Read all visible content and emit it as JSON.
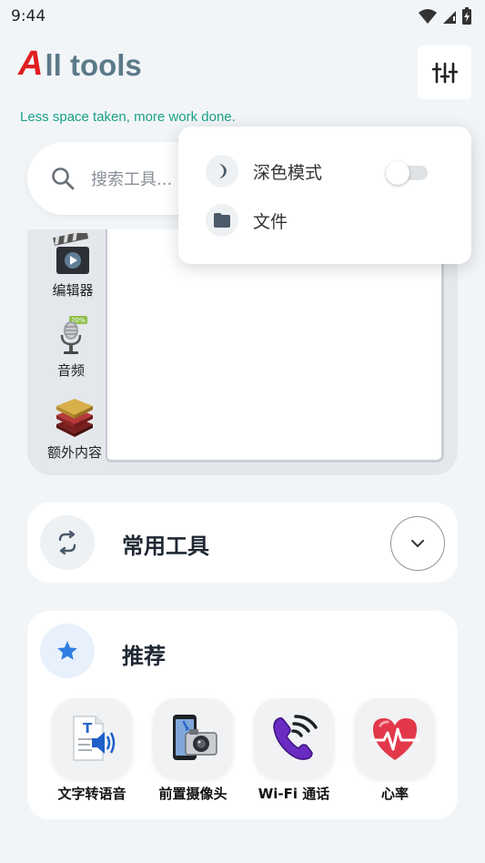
{
  "status_bar": {
    "time": "9:44"
  },
  "header": {
    "logo_letter": "A",
    "title_rest": "ll tools",
    "tagline": "Less space taken, more work done."
  },
  "search": {
    "placeholder": "搜索工具..."
  },
  "categories": [
    {
      "label": "编辑器",
      "icon": "video-clapper-icon"
    },
    {
      "label": "音频",
      "icon": "microphone-icon",
      "badge": "20%"
    },
    {
      "label": "额外内容",
      "icon": "layers-stack-icon"
    }
  ],
  "common_tools": {
    "title": "常用工具",
    "icon": "loop-arrows-icon"
  },
  "recommended": {
    "title": "推荐",
    "icon": "star-icon",
    "tools": [
      {
        "label": "文字转语音",
        "icon": "text-to-speech-icon"
      },
      {
        "label": "前置摄像头",
        "icon": "front-camera-icon"
      },
      {
        "label": "Wi-Fi 通话",
        "icon": "wifi-call-icon"
      },
      {
        "label": "心率",
        "icon": "heart-rate-icon"
      }
    ]
  },
  "menu": {
    "items": [
      {
        "label": "深色模式",
        "icon": "moon-icon",
        "toggle": false
      },
      {
        "label": "文件",
        "icon": "folder-icon"
      }
    ]
  },
  "colors": {
    "accent_red": "#e01e1e",
    "title_slate": "#5b7a88",
    "tagline_teal": "#1aa08a",
    "star_blue": "#2f7de1"
  }
}
